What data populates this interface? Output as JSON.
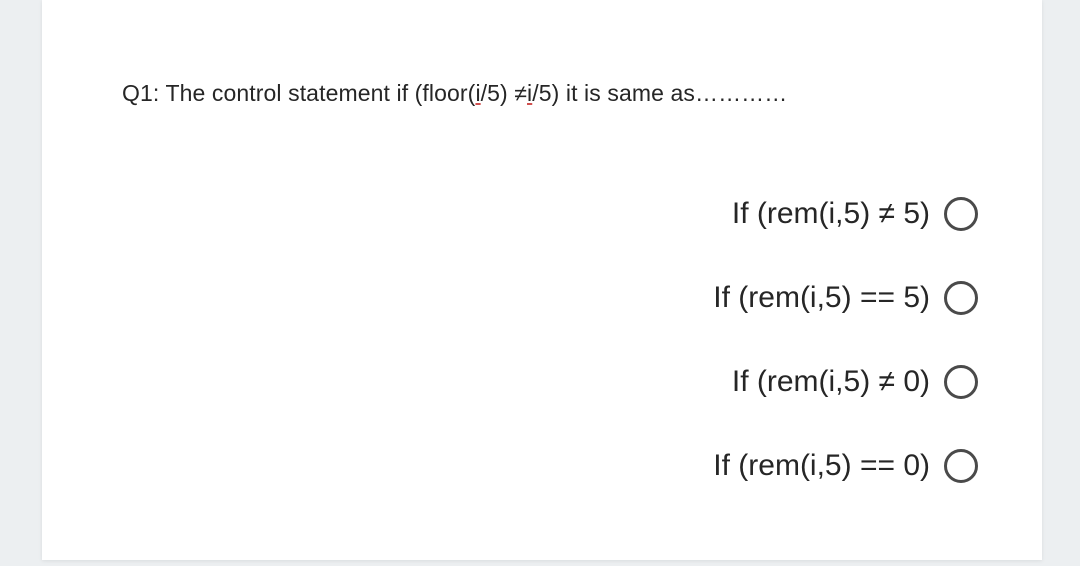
{
  "question": {
    "prefix": "Q1: The control statement if (floor(",
    "arg_i1": "i",
    "mid1": "/5) ≠",
    "arg_i2": "i",
    "mid2": "/5) it is same as…………"
  },
  "options": [
    {
      "text": "If (rem(i,5) ≠ 5)"
    },
    {
      "text": "If (rem(i,5) == 5)"
    },
    {
      "text": "If (rem(i,5) ≠ 0)"
    },
    {
      "text": "If (rem(i,5) == 0)"
    }
  ]
}
